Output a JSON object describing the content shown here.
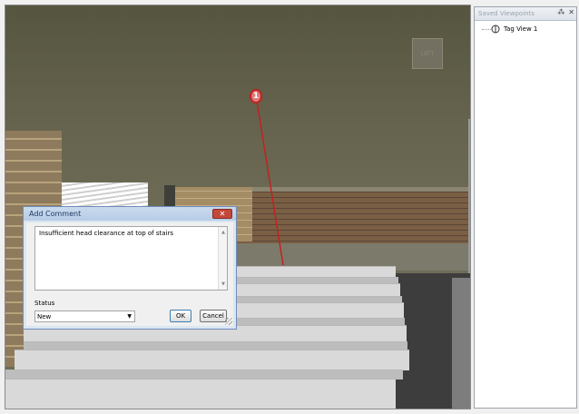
{
  "viewport": {
    "cube_label": "LEFT",
    "tag_number": "1"
  },
  "dialog": {
    "title": "Add Comment",
    "close_label": "✕",
    "comment_text": "Insufficient head clearance at top of stairs",
    "status_label": "Status",
    "status_value": "New",
    "ok_label": "OK",
    "cancel_label": "Cancel"
  },
  "panel": {
    "title": "Saved Viewpoints",
    "pin_label": "⁂",
    "close_label": "✕",
    "items": [
      {
        "label": "Tag View 1",
        "icon": "viewpoint-icon"
      }
    ]
  },
  "colors": {
    "tag_red": "#c42020",
    "dialog_border": "#6f8cb8",
    "ceiling": "#5f5e48"
  }
}
